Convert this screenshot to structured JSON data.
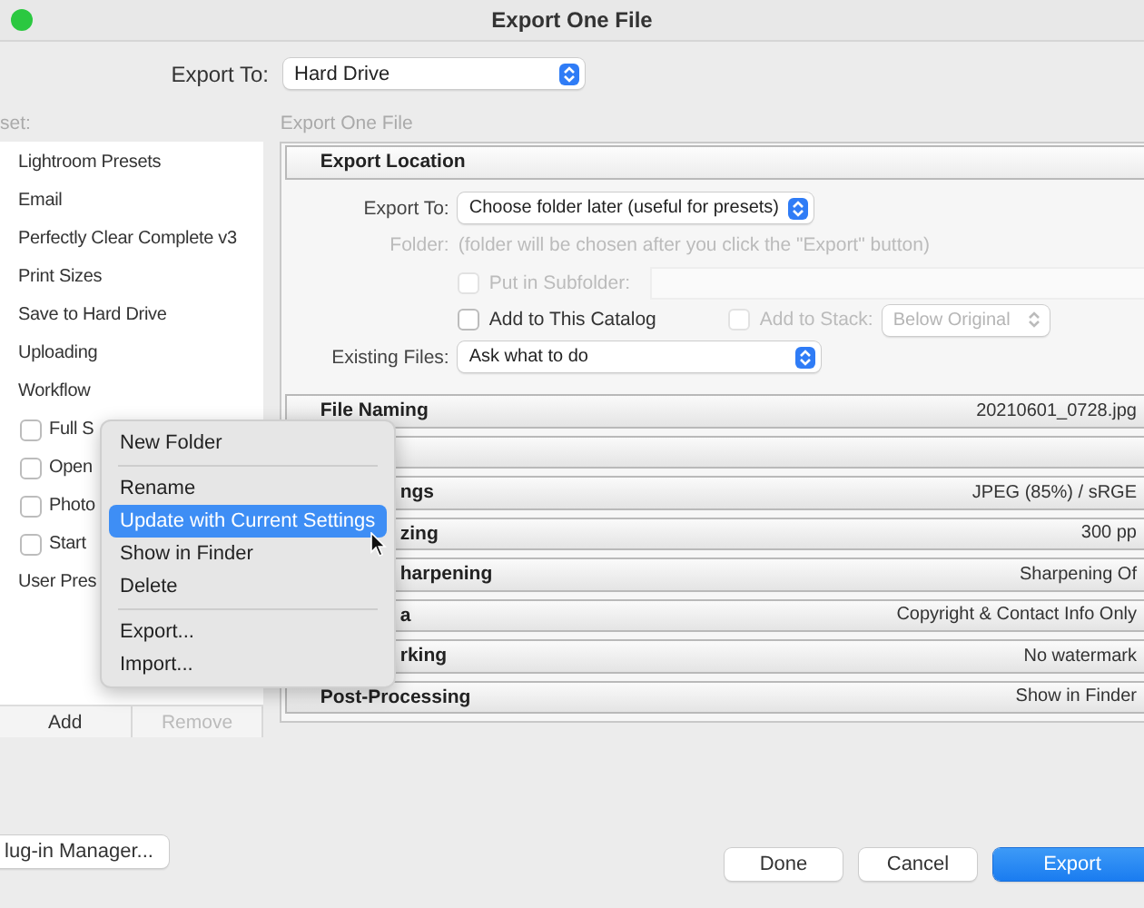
{
  "window": {
    "title": "Export One File"
  },
  "export_to": {
    "label": "Export To:",
    "value": "Hard Drive"
  },
  "preset_panel": {
    "label": "set:",
    "items": [
      {
        "kind": "folder",
        "label": "Lightroom Presets"
      },
      {
        "kind": "folder",
        "label": "Email"
      },
      {
        "kind": "folder",
        "label": "Perfectly Clear Complete v3"
      },
      {
        "kind": "folder",
        "label": "Print Sizes"
      },
      {
        "kind": "folder",
        "label": "Save to Hard Drive"
      },
      {
        "kind": "folder",
        "label": "Uploading"
      },
      {
        "kind": "folder",
        "label": "Workflow"
      },
      {
        "kind": "preset",
        "label": "Full S",
        "checked": false
      },
      {
        "kind": "preset",
        "label": "Open",
        "checked": false
      },
      {
        "kind": "preset",
        "label": "Photo",
        "checked": false
      },
      {
        "kind": "preset",
        "label": "Start",
        "checked": false
      },
      {
        "kind": "folder",
        "label": "User Pres"
      }
    ],
    "buttons": [
      {
        "label": "Add",
        "disabled": false
      },
      {
        "label": "Remove",
        "disabled": true
      }
    ]
  },
  "settings": {
    "label": "Export One File",
    "sections": [
      {
        "title": "Export Location",
        "expanded": true,
        "clipped": false
      },
      {
        "title": "File Naming",
        "value": "20210601_0728.jpg",
        "expanded": false,
        "clipped": false
      },
      {
        "expanded": false
      },
      {
        "title": "ngs",
        "value": "JPEG (85%) / sRGE",
        "expanded": false,
        "clipped": true
      },
      {
        "title": "zing",
        "value": "300 pp",
        "expanded": false,
        "clipped": true
      },
      {
        "title": "harpening",
        "value": "Sharpening Of",
        "expanded": false,
        "clipped": true
      },
      {
        "title": "a",
        "value": "Copyright & Contact Info Only",
        "expanded": false,
        "clipped": true
      },
      {
        "title": "rking",
        "value": "No watermark",
        "expanded": false,
        "clipped": true
      },
      {
        "title": "Post-Processing",
        "value": "Show in Finder",
        "expanded": false,
        "clipped": false
      }
    ]
  },
  "export_location": {
    "export_to": {
      "label": "Export To:",
      "value": "Choose folder later (useful for presets)"
    },
    "folder": {
      "label": "Folder:",
      "text": "(folder will be chosen after you click the \"Export\" button)",
      "disabled": true
    },
    "subfolder": {
      "label": "Put in Subfolder:",
      "checked": false,
      "disabled": true
    },
    "add_to_catalog": {
      "label": "Add to This Catalog",
      "checked": false,
      "disabled": false
    },
    "add_to_stack": {
      "label": "Add to Stack:",
      "checked": false,
      "disabled": true,
      "value": "Below Original"
    },
    "existing_files": {
      "label": "Existing Files:",
      "value": "Ask what to do"
    }
  },
  "context_menu": {
    "groups": [
      [
        {
          "label": "New Folder",
          "selected": false
        }
      ],
      [
        {
          "label": "Rename",
          "selected": false
        },
        {
          "label": "Update with Current Settings",
          "selected": true
        },
        {
          "label": "Show in Finder",
          "selected": false
        },
        {
          "label": "Delete",
          "selected": false
        }
      ],
      [
        {
          "label": "Export...",
          "selected": false
        },
        {
          "label": "Import...",
          "selected": false
        }
      ]
    ]
  },
  "plugin_button": {
    "label": "lug-in Manager..."
  },
  "buttons": [
    {
      "label": "Done",
      "kind": "default"
    },
    {
      "label": "Cancel",
      "kind": "default"
    },
    {
      "label": "Export",
      "kind": "primary"
    }
  ]
}
